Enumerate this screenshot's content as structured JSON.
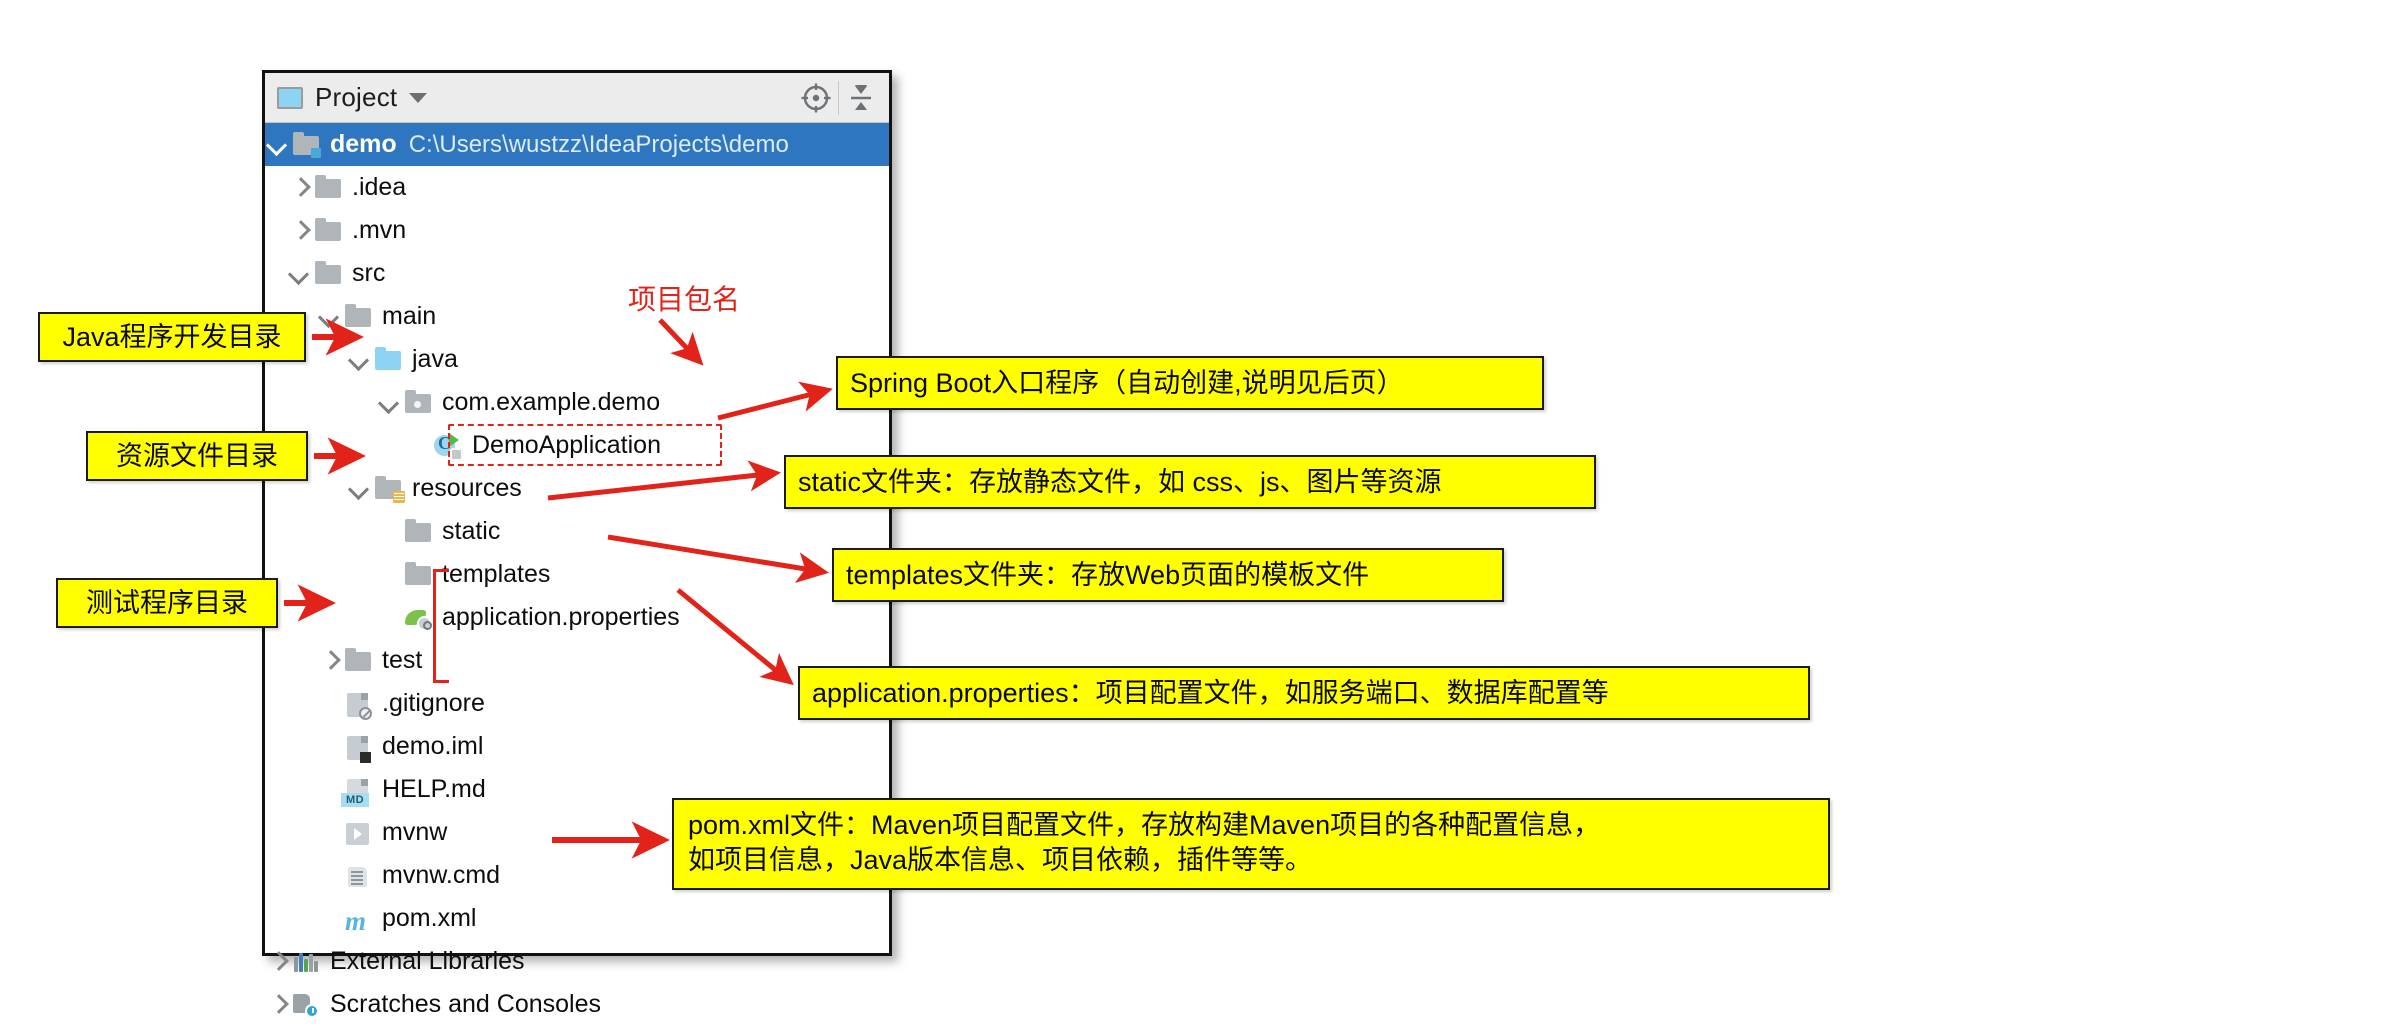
{
  "panel": {
    "header": {
      "title": "Project",
      "icon": "project-panel-icon",
      "caret": "chevron-down-icon",
      "buttons": [
        {
          "name": "locate-in-tree-icon",
          "label": ""
        },
        {
          "name": "collapse-all-icon",
          "label": ""
        }
      ]
    },
    "tree": [
      {
        "id": "demo",
        "label": "demo",
        "path": "C:\\Users\\wustzz\\IdeaProjects\\demo",
        "indent": 0,
        "arrow": "down",
        "icon": "folder-module",
        "selected": true,
        "bold": true
      },
      {
        "id": "idea",
        "label": ".idea",
        "path": "",
        "indent": 1,
        "arrow": "right",
        "icon": "folder",
        "selected": false,
        "bold": false
      },
      {
        "id": "mvn",
        "label": ".mvn",
        "path": "",
        "indent": 1,
        "arrow": "right",
        "icon": "folder",
        "selected": false,
        "bold": false
      },
      {
        "id": "src",
        "label": "src",
        "path": "",
        "indent": 1,
        "arrow": "down",
        "icon": "folder",
        "selected": false,
        "bold": false
      },
      {
        "id": "main",
        "label": "main",
        "path": "",
        "indent": 2,
        "arrow": "down",
        "icon": "folder",
        "selected": false,
        "bold": false
      },
      {
        "id": "java",
        "label": "java",
        "path": "",
        "indent": 3,
        "arrow": "down",
        "icon": "folder-source",
        "selected": false,
        "bold": false
      },
      {
        "id": "package",
        "label": "com.example.demo",
        "path": "",
        "indent": 4,
        "arrow": "down",
        "icon": "folder-package",
        "selected": false,
        "bold": false
      },
      {
        "id": "demoapp",
        "label": "DemoApplication",
        "path": "",
        "indent": 5,
        "arrow": "none",
        "icon": "java-class-run",
        "selected": false,
        "bold": false
      },
      {
        "id": "resources",
        "label": "resources",
        "path": "",
        "indent": 3,
        "arrow": "down",
        "icon": "folder-resources",
        "selected": false,
        "bold": false
      },
      {
        "id": "static",
        "label": "static",
        "path": "",
        "indent": 4,
        "arrow": "none",
        "icon": "folder",
        "selected": false,
        "bold": false
      },
      {
        "id": "templates",
        "label": "templates",
        "path": "",
        "indent": 4,
        "arrow": "none",
        "icon": "folder",
        "selected": false,
        "bold": false
      },
      {
        "id": "appprops",
        "label": "application.properties",
        "path": "",
        "indent": 4,
        "arrow": "none",
        "icon": "spring-properties",
        "selected": false,
        "bold": false
      },
      {
        "id": "test",
        "label": "test",
        "path": "",
        "indent": 2,
        "arrow": "right",
        "icon": "folder",
        "selected": false,
        "bold": false
      },
      {
        "id": "gitignore",
        "label": ".gitignore",
        "path": "",
        "indent": 2,
        "arrow": "none",
        "icon": "file-ignored",
        "selected": false,
        "bold": false
      },
      {
        "id": "demoiml",
        "label": "demo.iml",
        "path": "",
        "indent": 2,
        "arrow": "none",
        "icon": "file-iml",
        "selected": false,
        "bold": false
      },
      {
        "id": "helpmd",
        "label": "HELP.md",
        "path": "",
        "indent": 2,
        "arrow": "none",
        "icon": "file-markdown",
        "selected": false,
        "bold": false
      },
      {
        "id": "mvnw",
        "label": "mvnw",
        "path": "",
        "indent": 2,
        "arrow": "none",
        "icon": "file-executable",
        "selected": false,
        "bold": false
      },
      {
        "id": "mvnwcmd",
        "label": "mvnw.cmd",
        "path": "",
        "indent": 2,
        "arrow": "none",
        "icon": "file-text",
        "selected": false,
        "bold": false
      },
      {
        "id": "pomxml",
        "label": "pom.xml",
        "path": "",
        "indent": 2,
        "arrow": "none",
        "icon": "maven-icon",
        "selected": false,
        "bold": false
      },
      {
        "id": "extlibs",
        "label": "External Libraries",
        "path": "",
        "indent": 0,
        "arrow": "right",
        "icon": "libraries-icon",
        "selected": false,
        "bold": false
      },
      {
        "id": "scratches",
        "label": "Scratches and Consoles",
        "path": "",
        "indent": 0,
        "arrow": "right",
        "icon": "scratches-icon",
        "selected": false,
        "bold": false
      }
    ]
  },
  "annotations": {
    "left": [
      {
        "id": "java-dir",
        "text": "Java程序开发目录"
      },
      {
        "id": "resources-dir",
        "text": "资源文件目录"
      },
      {
        "id": "test-dir",
        "text": "测试程序目录"
      }
    ],
    "right": [
      {
        "id": "springboot-entry",
        "text": "Spring Boot入口程序（自动创建,说明见后页）"
      },
      {
        "id": "static-folder",
        "text": "static文件夹：存放静态文件，如 css、js、图片等资源"
      },
      {
        "id": "templates-folder",
        "text": "templates文件夹：存放Web页面的模板文件"
      },
      {
        "id": "app-properties",
        "text": "application.properties：项目配置文件，如服务端口、数据库配置等"
      }
    ],
    "pom": {
      "id": "pom-xml-note",
      "line1": "pom.xml文件：Maven项目配置文件，存放构建Maven项目的各种配置信息，",
      "line2": "如项目信息，Java版本信息、项目依赖，插件等等。"
    },
    "package_note": {
      "id": "package-name-note",
      "text": "项目包名"
    }
  },
  "colors": {
    "highlight": "#2f76c0",
    "annotation_bg": "#ffff00",
    "annotation_border": "#1b1b1b",
    "arrow_red": "#e2231a",
    "panel_header": "#ececec"
  }
}
